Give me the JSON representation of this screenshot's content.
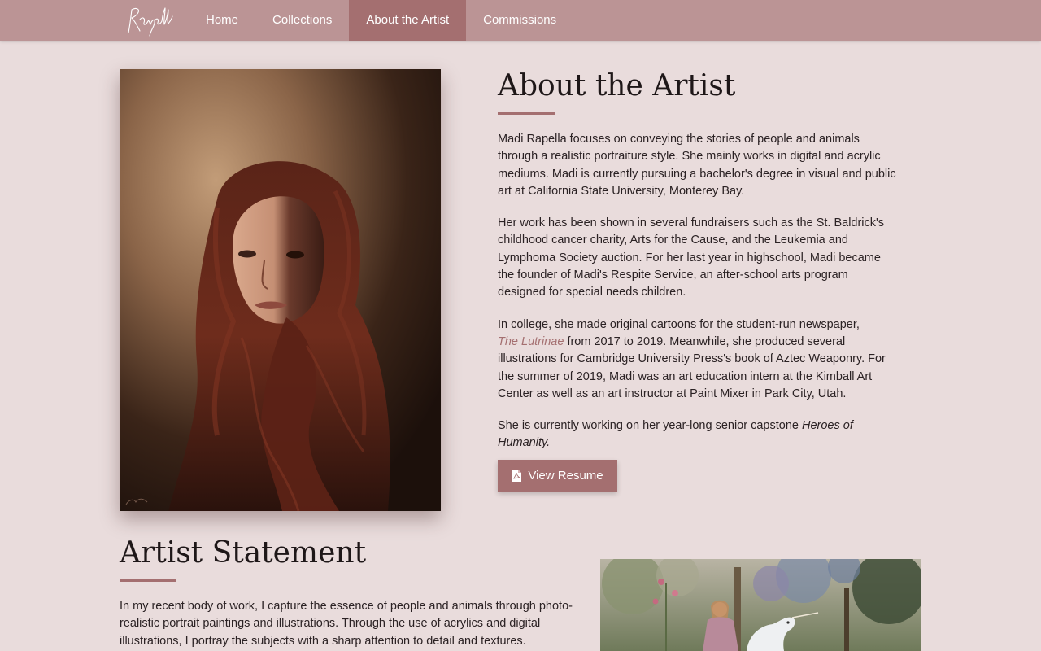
{
  "nav": {
    "brand": "Rapella",
    "items": [
      {
        "label": "Home",
        "active": false
      },
      {
        "label": "Collections",
        "active": false
      },
      {
        "label": "About the Artist",
        "active": true
      },
      {
        "label": "Commissions",
        "active": false
      }
    ]
  },
  "about": {
    "title": "About the Artist",
    "p1": "Madi Rapella focuses on conveying the stories of people and animals through a realistic portraiture style. She mainly works in digital and acrylic mediums. Madi is currently pursuing a bachelor's degree in visual and public art at California State University, Monterey Bay.",
    "p2": "Her work has been shown in several fundraisers such as the St. Baldrick's childhood cancer charity, Arts for the Cause, and the Leukemia and Lymphoma Society auction. For her last year in highschool, Madi became the founder of Madi's Respite Service, an after-school arts program designed for special needs children.",
    "p3_before": "In college, she made original cartoons for the student-run newspaper,",
    "p3_link": "The Lutrinae",
    "p3_after": " from 2017 to 2019. Meanwhile, she produced several illustrations for Cambridge University Press's book of Aztec Weaponry. For the summer of 2019, Madi was an art education intern at the Kimball Art Center as well as an art instructor at Paint Mixer in Park City, Utah.",
    "p4_before": "She is currently working on her year-long senior capstone ",
    "p4_italic": "Heroes of Humanity.",
    "resume_label": "View Resume",
    "resume_icon": "pdf-file-icon"
  },
  "statement": {
    "title": "Artist Statement",
    "p1": "In my recent body of work, I capture the essence of people and animals through photo-realistic portrait paintings and illustrations. Through the use of acrylics and digital illustrations, I portray the subjects with a sharp attention to detail and textures."
  },
  "colors": {
    "background": "#e9dcdc",
    "navbar": "#bb9495",
    "accent": "#a46f70"
  }
}
